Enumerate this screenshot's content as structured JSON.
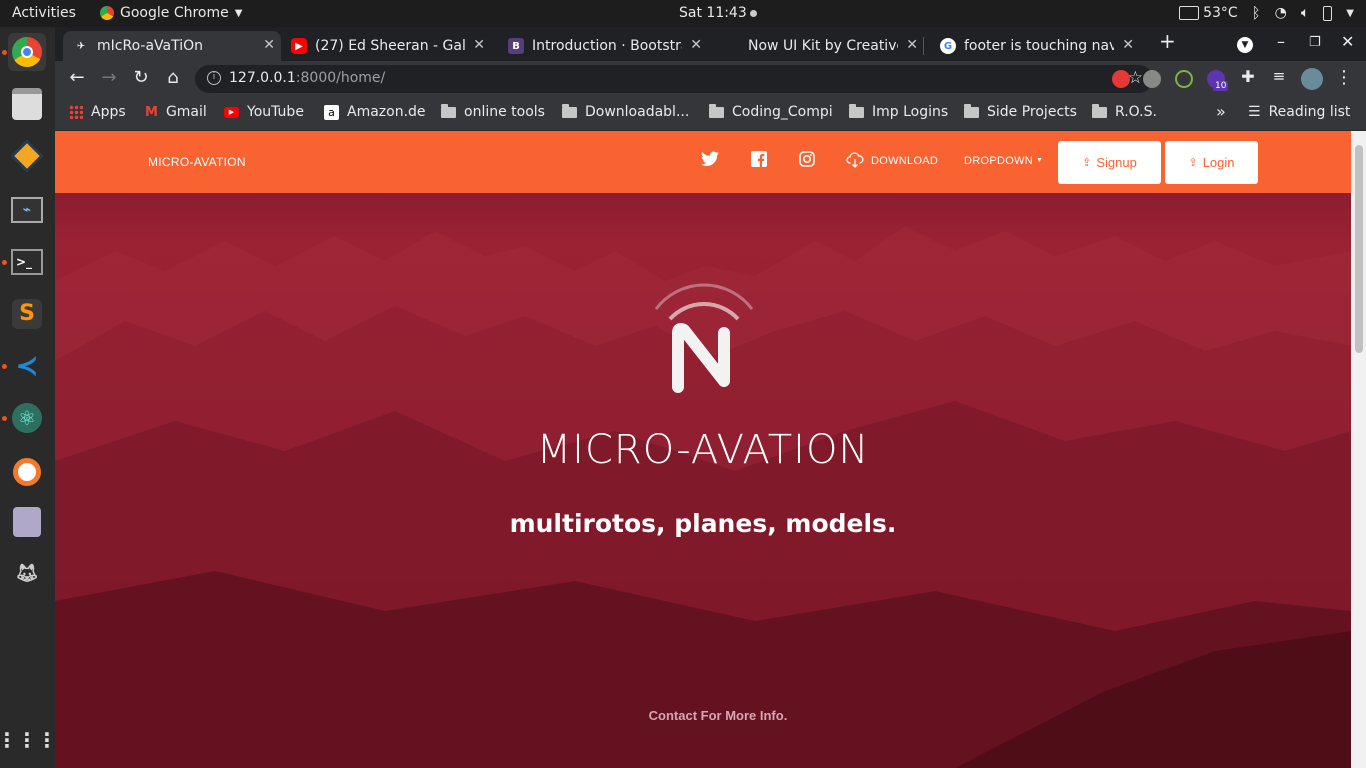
{
  "os": {
    "activities": "Activities",
    "app_name": "Google Chrome",
    "clock": "Sat 11:43",
    "temperature": "53°C"
  },
  "tabs": [
    {
      "title": "mIcRo-aVaTiOn",
      "favicon": "page-icon",
      "active": true
    },
    {
      "title": "(27) Ed Sheeran - Galwa",
      "favicon": "youtube-icon"
    },
    {
      "title": "Introduction · Bootstra",
      "favicon": "bootstrap-icon"
    },
    {
      "title": "Now UI Kit by Creative ",
      "favicon": "creative-tim-icon"
    },
    {
      "title": "footer is touching nav",
      "favicon": "google-icon"
    }
  ],
  "address": {
    "host": "127.0.0.1",
    "path": ":8000/home/"
  },
  "extensions": {
    "badge_count": "10"
  },
  "bookmarks": {
    "apps": "Apps",
    "items": [
      "Gmail",
      "YouTube",
      "Amazon.de",
      "online tools",
      "Downloadabl...",
      "Coding_Compi",
      "Imp Logins",
      "Side Projects",
      "R.O.S."
    ],
    "overflow": "»",
    "reading_list": "Reading list"
  },
  "site": {
    "brand": "MICRO-AVATION",
    "nav": {
      "download": "DOWNLOAD",
      "dropdown": "DROPDOWN",
      "signup": "Signup",
      "login": "Login"
    },
    "hero": {
      "title": "MICRO-AVATION",
      "subtitle": "multirotos, planes, models.",
      "contact": "Contact For More Info."
    },
    "colors": {
      "primary": "#f96332",
      "hero_overlay": "#8d1e2e"
    }
  }
}
